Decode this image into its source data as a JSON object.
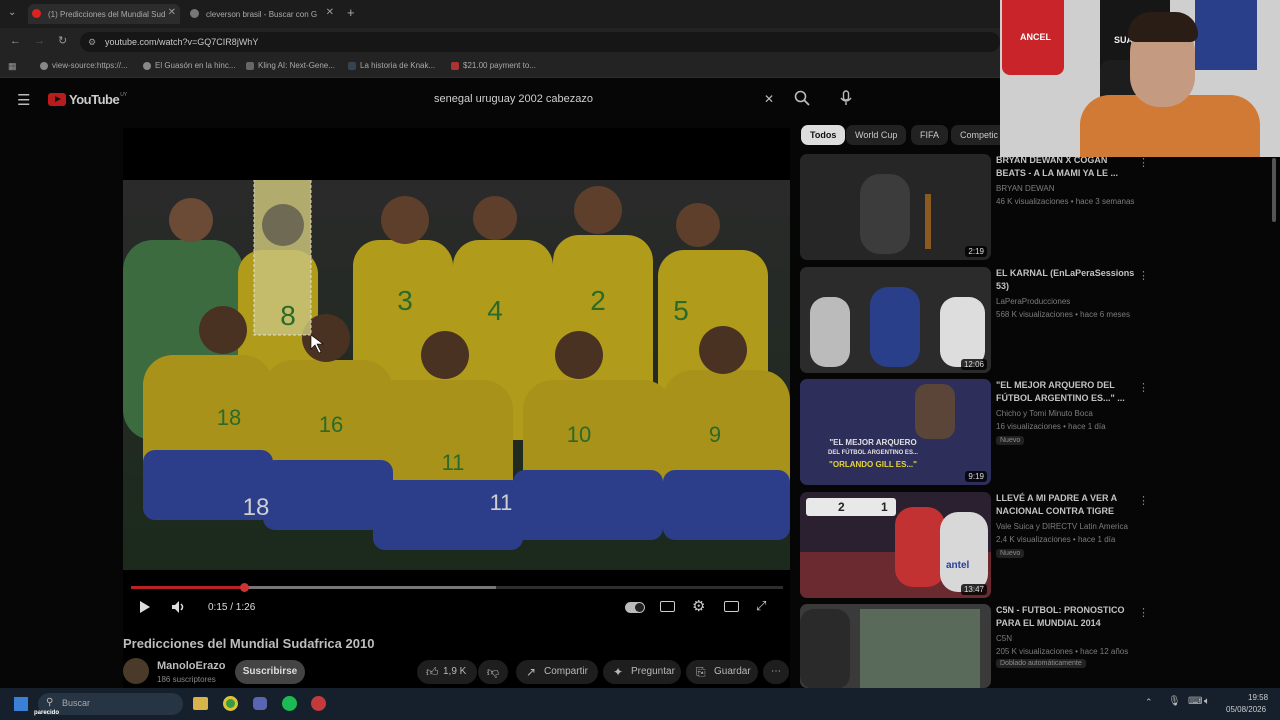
{
  "browser": {
    "tabs": [
      {
        "title": "(1) Predicciones del Mundial Sud"
      },
      {
        "title": "cleverson brasil - Buscar con G"
      }
    ],
    "url": "youtube.com/watch?v=GQ7CIR8jWhY",
    "bookmarks": [
      {
        "label": "view-source:https://..."
      },
      {
        "label": "El Guasón en la hinc..."
      },
      {
        "label": "Kling AI: Next-Gene..."
      },
      {
        "label": "La historia de Knak..."
      },
      {
        "label": "$21.00 payment to..."
      }
    ]
  },
  "youtube": {
    "logo": "YouTube",
    "logo_region": "UY",
    "search_query": "senegal uruguay 2002 cabezazo"
  },
  "player": {
    "time": "0:15 / 1:26",
    "progress_fraction": 0.174,
    "buffer_fraction": 0.56,
    "jersey_numbers": [
      "8",
      "3",
      "4",
      "2",
      "5",
      "18",
      "16",
      "11",
      "10",
      "9",
      "18",
      "11"
    ]
  },
  "video": {
    "title": "Predicciones del Mundial Sudafrica 2010",
    "channel": "ManoloErazo",
    "subscribers": "186 suscriptores",
    "subscribe_label": "Suscribirse",
    "likes": "1,9 K",
    "share_label": "Compartir",
    "ask_label": "Preguntar",
    "save_label": "Guardar"
  },
  "chips": [
    "Todos",
    "World Cup",
    "FIFA",
    "Competic"
  ],
  "recommendations": [
    {
      "title": "BRYAN DEWAN X COGAN BEATS - A LA MAMI YA LE ...",
      "channel": "BRYAN DEWAN",
      "meta": "46 K visualizaciones • hace 3 semanas",
      "duration": "2:19",
      "badge": ""
    },
    {
      "title": "EL KARNAL (EnLaPeraSessions 53)",
      "channel": "LaPeraProducciones",
      "meta": "568 K visualizaciones • hace 6 meses",
      "duration": "12:06",
      "badge": ""
    },
    {
      "title": "\"EL MEJOR ARQUERO DEL FÚTBOL ARGENTINO ES...\" ...",
      "channel": "Chicho y Tomi Minuto Boca",
      "meta": "16 visualizaciones • hace 1 día",
      "duration": "9:19",
      "badge": "Nuevo",
      "thumb_text": [
        "\"EL MEJOR ARQUERO",
        "DEL FÚTBOL ARGENTINO ES...",
        "\"ORLANDO GILL ES...\""
      ]
    },
    {
      "title": "LLEVÉ A MI PADRE A VER A NACIONAL CONTRA TIGRE",
      "channel": "Vale Suica y DIRECTV Latin America",
      "meta": "2,4 K visualizaciones • hace 1 día",
      "duration": "13:47",
      "badge": "Nuevo",
      "thumb_text": [
        "2",
        "1",
        "antel"
      ]
    },
    {
      "title": "C5N - FUTBOL: PRONOSTICO PARA EL MUNDIAL 2014",
      "channel": "C5N",
      "meta": "205 K visualizaciones • hace 12 años",
      "duration": "",
      "badge": "Doblado automáticamente"
    }
  ],
  "taskbar": {
    "search_placeholder": "Buscar",
    "time": "19:58",
    "date": "05/08/2026",
    "overlay_text": "parecido"
  },
  "webcam": {
    "jersey_text": [
      "ANCEL",
      "SUAREZ"
    ]
  }
}
